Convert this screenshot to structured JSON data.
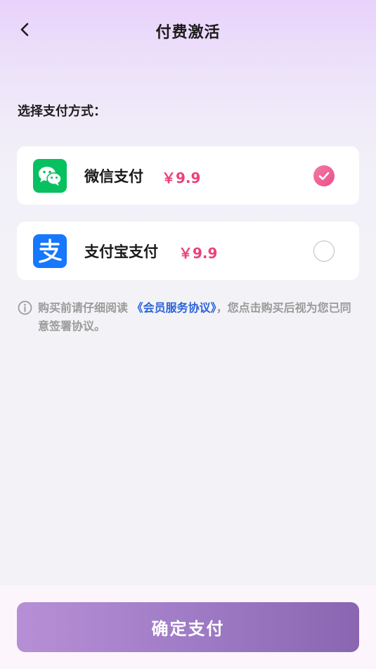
{
  "header": {
    "title": "付费激活",
    "back_icon": "chevron-left-icon"
  },
  "section_label": "选择支付方式：",
  "payment_methods": [
    {
      "name": "微信支付",
      "price": "￥9.9",
      "icon": "wechat-pay-icon",
      "selected": true,
      "brand_color": "#07C160"
    },
    {
      "name": "支付宝支付",
      "price": "￥9.9",
      "icon": "alipay-icon",
      "selected": false,
      "brand_color": "#1677FF"
    }
  ],
  "notice": {
    "icon": "info-icon",
    "prefix": "购买前请仔细阅读",
    "agreement_link": "《会员服务协议》",
    "suffix": "，您点击购买后视为您已同意签署协议。"
  },
  "confirm_button": "确定支付",
  "colors": {
    "price": "#EC407A",
    "link": "#2C63D6",
    "selected_radio": "#EA4F88",
    "button_gradient_start": "#B78FD6",
    "button_gradient_end": "#8A65B0"
  }
}
